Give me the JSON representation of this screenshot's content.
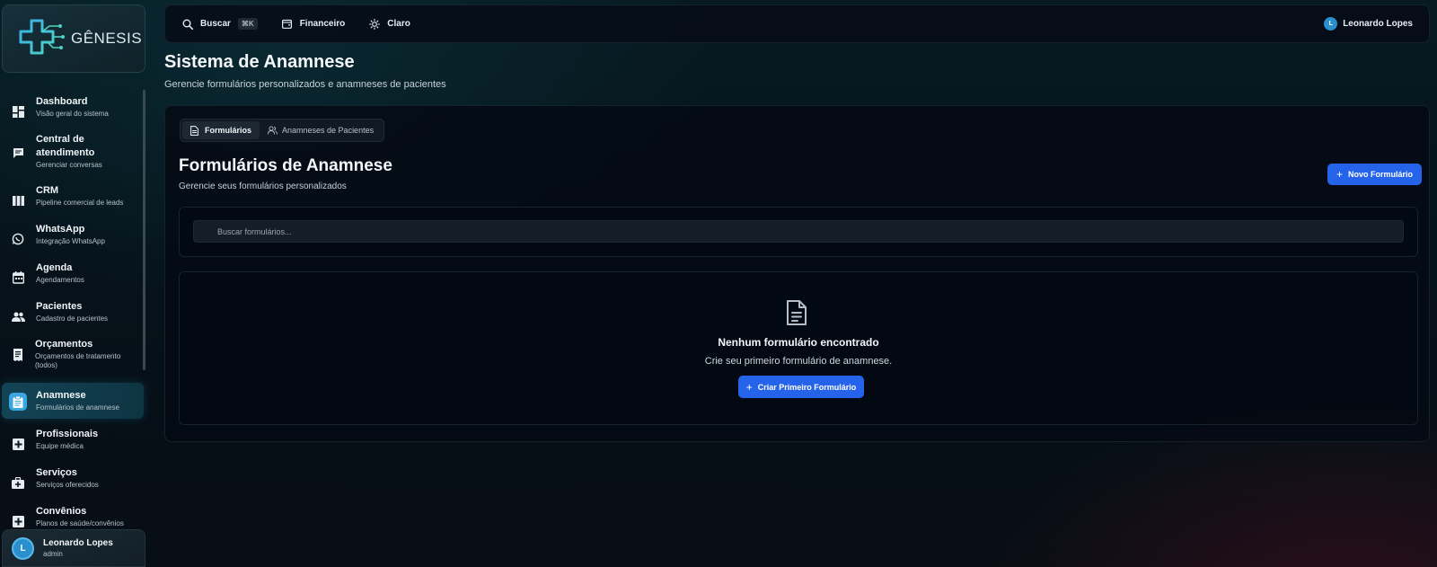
{
  "brand": {
    "name": "GÊNESIS"
  },
  "topbar": {
    "search_label": "Buscar",
    "search_shortcut": "⌘K",
    "finance_label": "Financeiro",
    "theme_label": "Claro",
    "user_initial": "L",
    "user_name": "Leonardo Lopes"
  },
  "sidebar": {
    "items": [
      {
        "label": "Dashboard",
        "sub": "Visão geral do sistema",
        "icon": "dashboard-icon"
      },
      {
        "label": "Central de atendimento",
        "sub": "Gerenciar conversas",
        "icon": "chat-icon"
      },
      {
        "label": "CRM",
        "sub": "Pipeline comercial de leads",
        "icon": "columns-icon"
      },
      {
        "label": "WhatsApp",
        "sub": "Integração WhatsApp",
        "icon": "whatsapp-icon"
      },
      {
        "label": "Agenda",
        "sub": "Agendamentos",
        "icon": "calendar-icon"
      },
      {
        "label": "Pacientes",
        "sub": "Cadastro de pacientes",
        "icon": "people-icon"
      },
      {
        "label": "Orçamentos",
        "sub": "Orçamentos de tratamento (todos)",
        "icon": "receipt-icon"
      },
      {
        "label": "Anamnese",
        "sub": "Formulários de anamnese",
        "icon": "clipboard-icon",
        "active": true
      },
      {
        "label": "Profissionais",
        "sub": "Equipe médica",
        "icon": "medical-plus-icon"
      },
      {
        "label": "Serviços",
        "sub": "Serviços oferecidos",
        "icon": "medkit-icon"
      },
      {
        "label": "Convênios",
        "sub": "Planos de saúde/convênios",
        "icon": "medical-plus-icon"
      }
    ],
    "user": {
      "initial": "L",
      "name": "Leonardo Lopes",
      "role": "admin"
    }
  },
  "page": {
    "title": "Sistema de Anamnese",
    "subtitle": "Gerencie formulários personalizados e anamneses de pacientes"
  },
  "tabs": [
    {
      "label": "Formulários",
      "active": true
    },
    {
      "label": "Anamneses de Pacientes",
      "active": false
    }
  ],
  "section": {
    "title": "Formulários de Anamnese",
    "subtitle": "Gerencie seus formulários personalizados",
    "new_button": "Novo Formulário"
  },
  "search": {
    "placeholder": "Buscar formulários..."
  },
  "empty": {
    "title": "Nenhum formulário encontrado",
    "subtitle": "Crie seu primeiro formulário de anamnese.",
    "button": "Criar Primeiro Formulário"
  },
  "colors": {
    "accent": "#2563eb",
    "active_nav": "#3aa7e0",
    "brand": "#3ab0e6"
  }
}
